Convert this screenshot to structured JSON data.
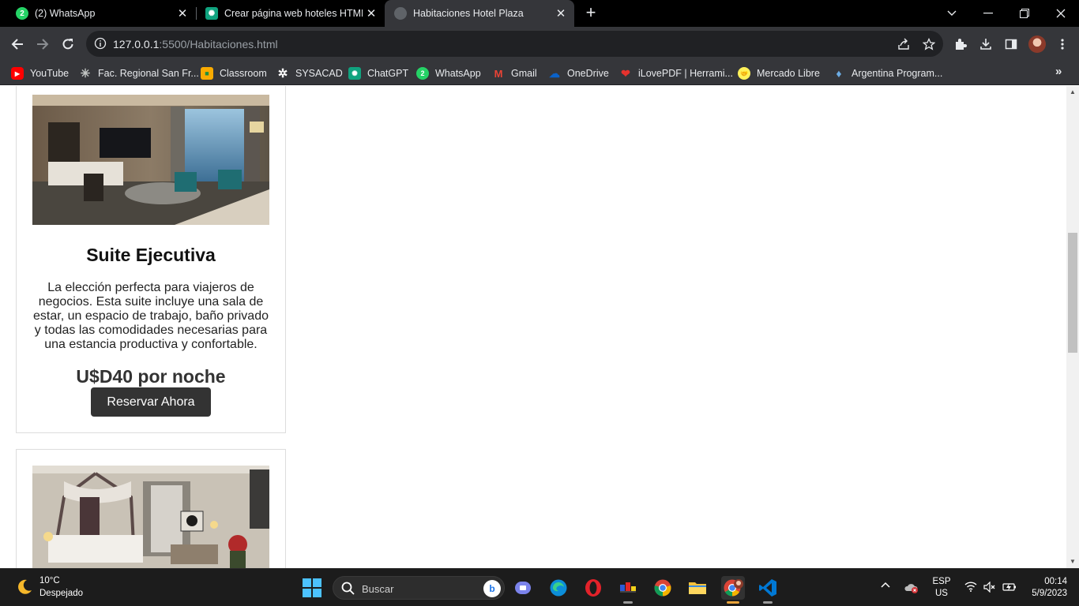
{
  "browser": {
    "tabs": [
      {
        "title": "(2) WhatsApp",
        "active": false,
        "favicon": "whatsapp-icon",
        "color": "#25d366"
      },
      {
        "title": "Crear página web hoteles HTML/",
        "active": false,
        "favicon": "chatgpt-icon",
        "color": "#10a37f"
      },
      {
        "title": "Habitaciones Hotel Plaza",
        "active": true,
        "favicon": "globe-icon",
        "color": "#5f6368"
      }
    ],
    "url_host": "127.0.0.1",
    "url_path": ":5500/Habitaciones.html",
    "bookmarks": [
      {
        "label": "YouTube",
        "icon": "youtube-icon",
        "color": "#ff0000"
      },
      {
        "label": "Fac. Regional San Fr...",
        "icon": "utn-icon",
        "color": "#35363a"
      },
      {
        "label": "Classroom",
        "icon": "classroom-icon",
        "color": "#f9ab00"
      },
      {
        "label": "SYSACAD",
        "icon": "sysacad-icon",
        "color": "#35363a"
      },
      {
        "label": "ChatGPT",
        "icon": "chatgpt-icon",
        "color": "#10a37f"
      },
      {
        "label": "WhatsApp",
        "icon": "whatsapp-icon",
        "color": "#25d366"
      },
      {
        "label": "Gmail",
        "icon": "gmail-icon",
        "color": "#ea4335"
      },
      {
        "label": "OneDrive",
        "icon": "onedrive-icon",
        "color": "#0a62c9"
      },
      {
        "label": "iLovePDF | Herrami...",
        "icon": "ilovepdf-icon",
        "color": "#e5322d"
      },
      {
        "label": "Mercado Libre",
        "icon": "mercadolibre-icon",
        "color": "#fff159"
      },
      {
        "label": "Argentina Program...",
        "icon": "argentina-icon",
        "color": "#6cace4"
      }
    ]
  },
  "page": {
    "rooms": [
      {
        "title": "Suite Ejecutiva",
        "description": "La elección perfecta para viajeros de negocios. Esta suite incluye una sala de estar, un espacio de trabajo, baño privado y todas las comodidades necesarias para una estancia productiva y confortable.",
        "price": "U$D40 por noche",
        "button": "Reservar Ahora"
      },
      {
        "title": "",
        "description": "",
        "price": "",
        "button": ""
      }
    ]
  },
  "taskbar": {
    "weather_temp": "10°C",
    "weather_desc": "Despejado",
    "search_placeholder": "Buscar",
    "lang_1": "ESP",
    "lang_2": "US",
    "time": "00:14",
    "date": "5/9/2023"
  }
}
